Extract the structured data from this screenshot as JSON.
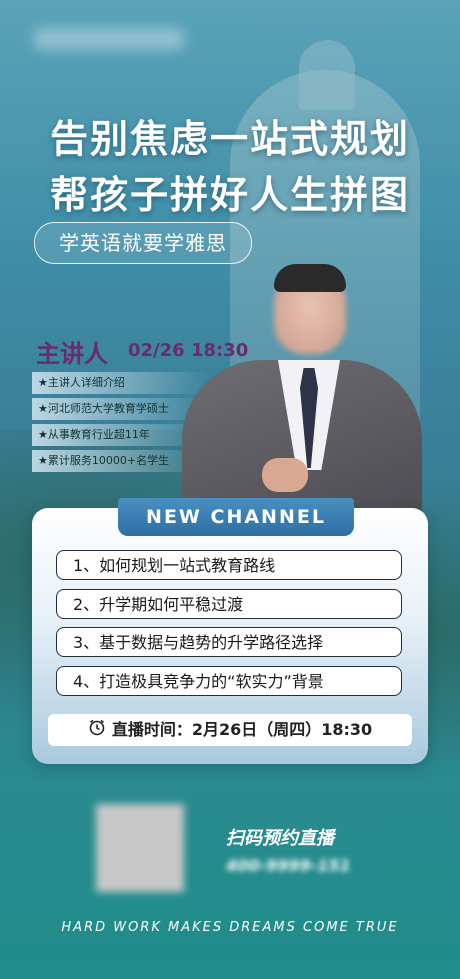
{
  "headline": {
    "line1": "告别焦虑一站式规划",
    "line2": "帮孩子拼好人生拼图"
  },
  "subtitle": "学英语就要学雅思",
  "speaker": {
    "label": "主讲人",
    "time": "02/26 18:30",
    "bullets": [
      "★主讲人详细介绍",
      "★河北师范大学教育学硕士",
      "★从事教育行业超11年",
      "★累计服务10000+名学生"
    ]
  },
  "channel": {
    "title": "NEW CHANNEL",
    "topics": [
      "1、如何规划一站式教育路线",
      "2、升学期如何平稳过渡",
      "3、基于数据与趋势的升学路径选择",
      "4、打造极具竞争力的“软实力”背景"
    ],
    "live_time": "直播时间：2月26日（周四）18:30"
  },
  "qr": {
    "label": "扫码预约直播",
    "phone": "400-9999-151"
  },
  "footer": "HARD WORK MAKES DREAMS COME TRUE",
  "colors": {
    "accent": "#2d6fa3",
    "speaker": "#6a2a72"
  },
  "icons": {
    "clock": "alarm-clock-icon"
  }
}
